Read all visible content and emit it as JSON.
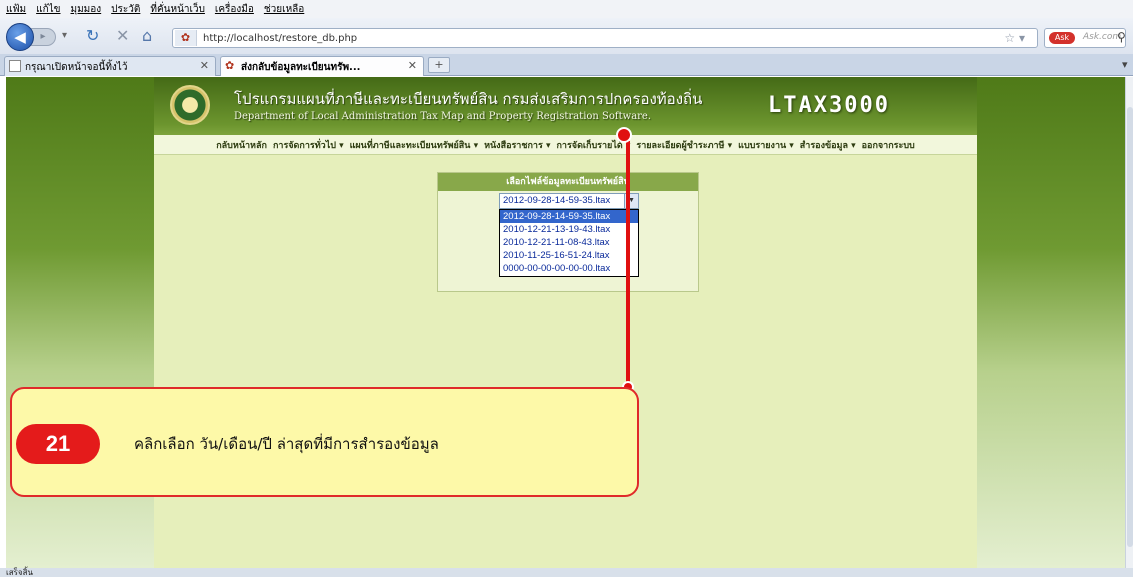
{
  "menu": [
    "แฟ้ม",
    "แก้ไข",
    "มุมมอง",
    "ประวัติ",
    "ที่คั่นหน้าเว็บ",
    "เครื่องมือ",
    "ช่วยเหลือ"
  ],
  "address": {
    "url": "http://localhost/restore_db.php"
  },
  "search": {
    "placeholder": "Ask.com",
    "logo": "Ask"
  },
  "tabs": [
    {
      "label": "กรุณาเปิดหน้าจอนี้ทิ้งไว้"
    },
    {
      "label": "ส่งกลับข้อมูลทะเบียนทรัพ..."
    }
  ],
  "banner": {
    "title_th": "โปรแกรมแผนที่ภาษีและทะเบียนทรัพย์สิน กรมส่งเสริมการปกครองท้องถิ่น",
    "title_en": "Department of Local Administration Tax Map and Property Registration Software.",
    "brand": "LTAX3000"
  },
  "site_menu": [
    "กลับหน้าหลัก",
    "การจัดการทั่วไป ▾",
    "แผนที่ภาษีและทะเบียนทรัพย์สิน ▾",
    "หนังสือราชการ ▾",
    "การจัดเก็บรายได้ ▾",
    "รายละเอียดผู้ชำระภาษี ▾",
    "แบบรายงาน ▾",
    "สำรองข้อมูล ▾",
    "ออกจากระบบ"
  ],
  "panel": {
    "title": "เลือกไฟล์ข้อมูลทะเบียนทรัพย์สิน",
    "selected": "2012-09-28-14-59-35.ltax",
    "options": [
      "2012-09-28-14-59-35.ltax",
      "2010-12-21-13-19-43.ltax",
      "2010-12-21-11-08-43.ltax",
      "2010-11-25-16-51-24.ltax",
      "0000-00-00-00-00-00.ltax"
    ]
  },
  "callout": {
    "step": "21",
    "text": "คลิกเลือก วัน/เดือน/ปี ล่าสุดที่มีการสำรองข้อมูล"
  },
  "status": "เสร็จสิ้น",
  "colors": {
    "accent_red": "#e01010",
    "callout_bg": "#fdf9a8",
    "banner_green": "#5f8c24"
  }
}
